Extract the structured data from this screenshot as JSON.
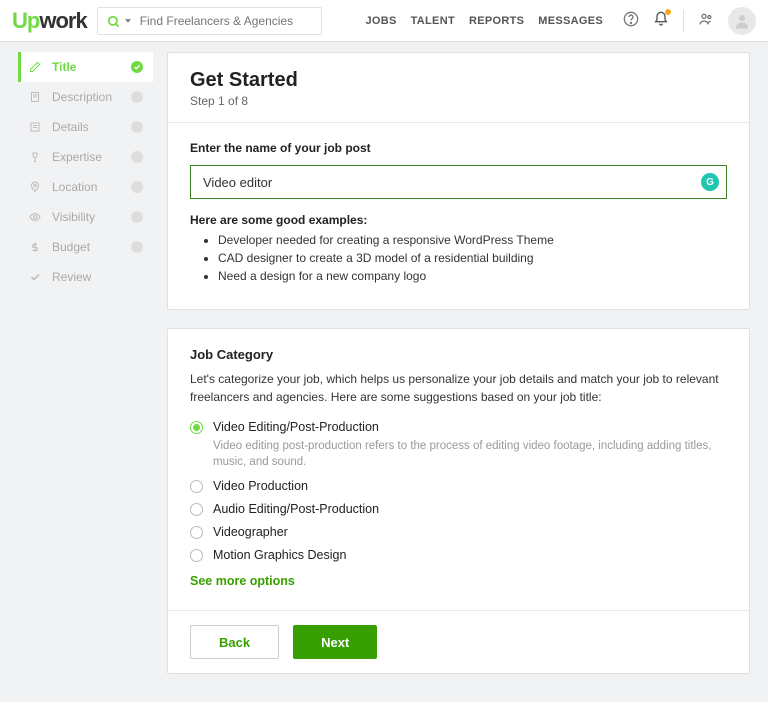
{
  "header": {
    "logo_green": "Up",
    "logo_dark": "work",
    "search_placeholder": "Find Freelancers & Agencies",
    "nav": [
      "JOBS",
      "TALENT",
      "REPORTS",
      "MESSAGES"
    ]
  },
  "sidebar": {
    "steps": [
      {
        "label": "Title",
        "active": true,
        "icon": "pencil"
      },
      {
        "label": "Description",
        "active": false,
        "icon": "doc"
      },
      {
        "label": "Details",
        "active": false,
        "icon": "list"
      },
      {
        "label": "Expertise",
        "active": false,
        "icon": "trophy"
      },
      {
        "label": "Location",
        "active": false,
        "icon": "pin"
      },
      {
        "label": "Visibility",
        "active": false,
        "icon": "eye"
      },
      {
        "label": "Budget",
        "active": false,
        "icon": "dollar"
      },
      {
        "label": "Review",
        "active": false,
        "icon": "check"
      }
    ]
  },
  "title_card": {
    "heading": "Get Started",
    "step_counter": "Step 1 of 8",
    "field_label": "Enter the name of your job post",
    "input_value": "Video editor",
    "examples_heading": "Here are some good examples:",
    "examples": [
      "Developer needed for creating a responsive WordPress Theme",
      "CAD designer to create a 3D model of a residential building",
      "Need a design for a new company logo"
    ]
  },
  "category_card": {
    "heading": "Job Category",
    "description": "Let's categorize your job, which helps us personalize your job details and match your job to relevant freelancers and agencies. Here are some suggestions based on your job title:",
    "options": [
      {
        "label": "Video Editing/Post-Production",
        "selected": true,
        "desc": "Video editing post-production refers to the process of editing video footage, including adding titles, music, and sound."
      },
      {
        "label": "Video Production",
        "selected": false
      },
      {
        "label": "Audio Editing/Post-Production",
        "selected": false
      },
      {
        "label": "Videographer",
        "selected": false
      },
      {
        "label": "Motion Graphics Design",
        "selected": false
      }
    ],
    "see_more": "See more options",
    "back_label": "Back",
    "next_label": "Next"
  }
}
